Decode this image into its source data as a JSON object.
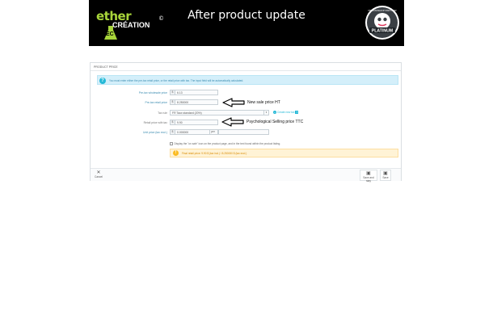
{
  "banner": {
    "title": "After product update",
    "logo": {
      "ether": "ether",
      "creation": "CRÉATION",
      "ec": "EC",
      "copyright": "©"
    },
    "badge": {
      "top": "PRESTASHOP PARTNER",
      "main": "PLATINUM"
    }
  },
  "panel": {
    "header": "PRODUCT PRICE",
    "info_text": "You must enter either the pre-tax retail price, or the retail price with tax. The input field will be automatically calculated.",
    "rows": {
      "wholesale": {
        "label": "Pre-tax wholesale price",
        "currency": "$",
        "value": "6.13"
      },
      "retail": {
        "label": "Pre-tax retail price",
        "currency": "$",
        "value": "8.250000"
      },
      "tax": {
        "label": "Tax rule",
        "value": "FR Taux standard (20%)",
        "create_link": "Create new tax"
      },
      "with_tax": {
        "label": "Retail price with tax",
        "currency": "$",
        "value": "9.90"
      },
      "unit": {
        "label": "Unit price (tax excl.)",
        "currency": "$",
        "value": "0.000000",
        "per": "per"
      }
    },
    "onsale_text": "Display the \"on sale\" icon on the product page, and in the text found within the product listing.",
    "warning_text": "Final retail price: 9.90 $ (tax incl.) / 8.250000 $ (tax excl.)"
  },
  "annotations": {
    "retail_note": "New sale price HT",
    "with_tax_note": "Psychological Selling price TTC"
  },
  "footer": {
    "cancel_label": "Cancel",
    "save_and_stay_label": "Save and stay",
    "save_label": "Save"
  },
  "colors": {
    "accent": "#25b9d7",
    "info_bg": "#d4effa",
    "warning_bg": "#fff3d6",
    "brand_green": "#a8d53a"
  }
}
